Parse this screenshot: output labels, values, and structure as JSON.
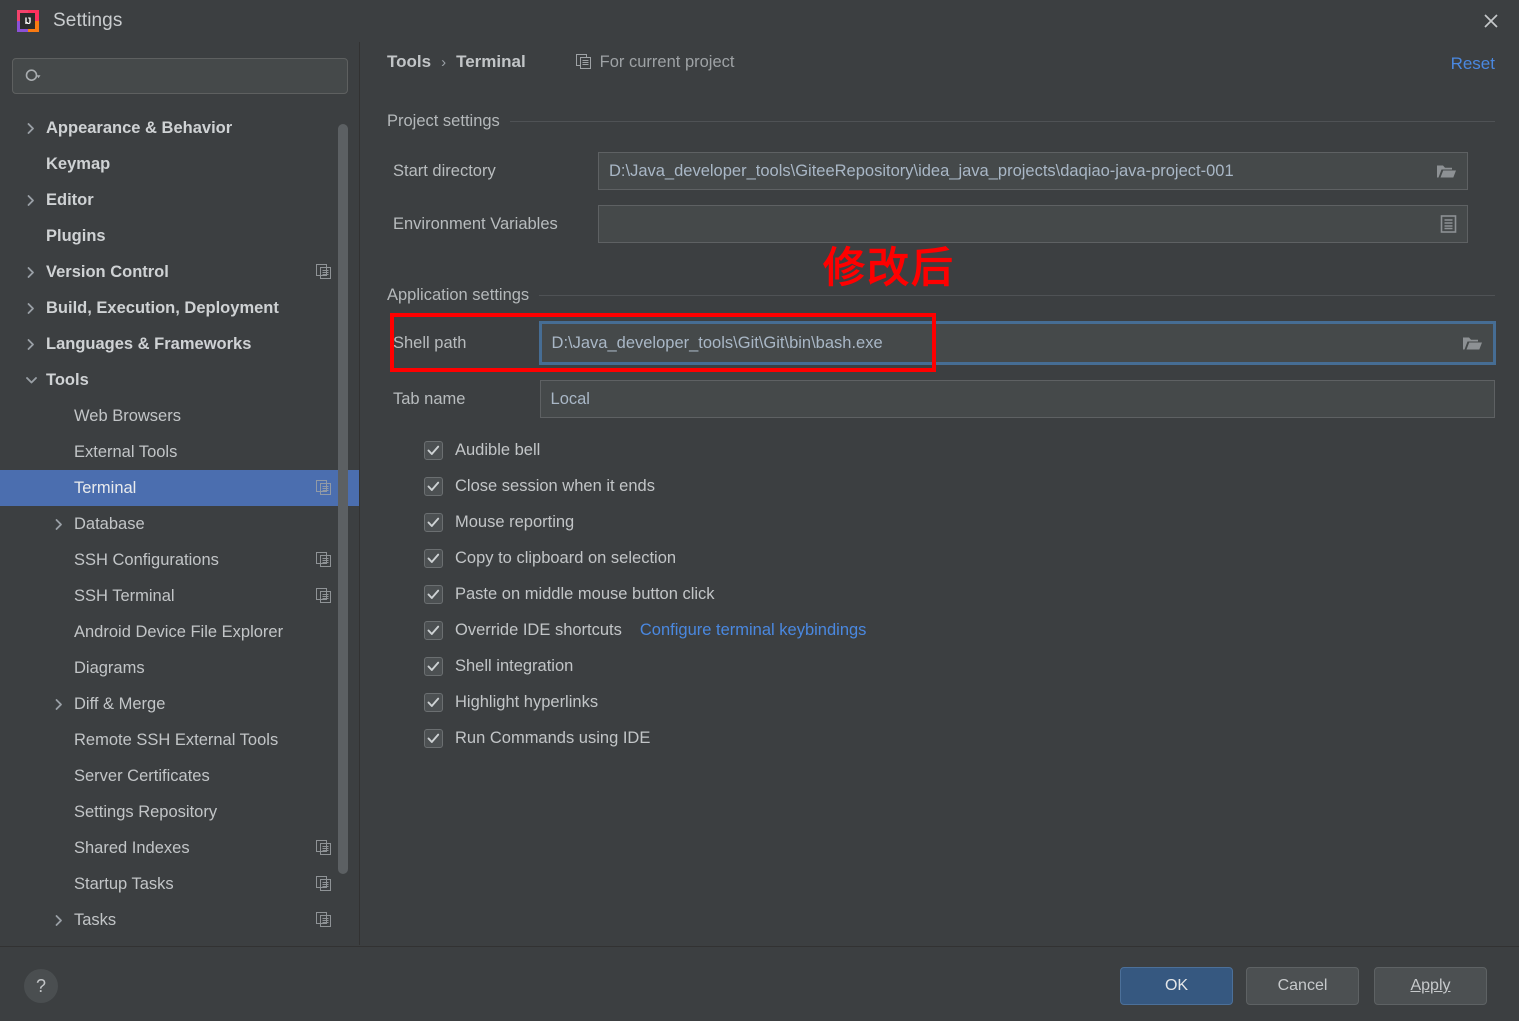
{
  "window": {
    "title": "Settings",
    "logo_badge": "IJ",
    "close_icon": "close-icon"
  },
  "search": {
    "placeholder": "",
    "value": "",
    "icon": "search-icon"
  },
  "sidebar": {
    "items": [
      {
        "label": "Appearance & Behavior",
        "indent": 0,
        "arrow": "right",
        "bold": true,
        "copy": false,
        "selected": false
      },
      {
        "label": "Keymap",
        "indent": 0,
        "arrow": "none",
        "bold": true,
        "copy": false,
        "selected": false
      },
      {
        "label": "Editor",
        "indent": 0,
        "arrow": "right",
        "bold": true,
        "copy": false,
        "selected": false
      },
      {
        "label": "Plugins",
        "indent": 0,
        "arrow": "none",
        "bold": true,
        "copy": false,
        "selected": false
      },
      {
        "label": "Version Control",
        "indent": 0,
        "arrow": "right",
        "bold": true,
        "copy": true,
        "selected": false
      },
      {
        "label": "Build, Execution, Deployment",
        "indent": 0,
        "arrow": "right",
        "bold": true,
        "copy": false,
        "selected": false
      },
      {
        "label": "Languages & Frameworks",
        "indent": 0,
        "arrow": "right",
        "bold": true,
        "copy": false,
        "selected": false
      },
      {
        "label": "Tools",
        "indent": 0,
        "arrow": "down",
        "bold": true,
        "copy": false,
        "selected": false
      },
      {
        "label": "Web Browsers",
        "indent": 1,
        "arrow": "none",
        "bold": false,
        "copy": false,
        "selected": false
      },
      {
        "label": "External Tools",
        "indent": 1,
        "arrow": "none",
        "bold": false,
        "copy": false,
        "selected": false
      },
      {
        "label": "Terminal",
        "indent": 1,
        "arrow": "none",
        "bold": false,
        "copy": true,
        "selected": true
      },
      {
        "label": "Database",
        "indent": 1,
        "arrow": "right",
        "bold": false,
        "copy": false,
        "selected": false
      },
      {
        "label": "SSH Configurations",
        "indent": 1,
        "arrow": "none",
        "bold": false,
        "copy": true,
        "selected": false
      },
      {
        "label": "SSH Terminal",
        "indent": 1,
        "arrow": "none",
        "bold": false,
        "copy": true,
        "selected": false
      },
      {
        "label": "Android Device File Explorer",
        "indent": 1,
        "arrow": "none",
        "bold": false,
        "copy": false,
        "selected": false
      },
      {
        "label": "Diagrams",
        "indent": 1,
        "arrow": "none",
        "bold": false,
        "copy": false,
        "selected": false
      },
      {
        "label": "Diff & Merge",
        "indent": 1,
        "arrow": "right",
        "bold": false,
        "copy": false,
        "selected": false
      },
      {
        "label": "Remote SSH External Tools",
        "indent": 1,
        "arrow": "none",
        "bold": false,
        "copy": false,
        "selected": false
      },
      {
        "label": "Server Certificates",
        "indent": 1,
        "arrow": "none",
        "bold": false,
        "copy": false,
        "selected": false
      },
      {
        "label": "Settings Repository",
        "indent": 1,
        "arrow": "none",
        "bold": false,
        "copy": false,
        "selected": false
      },
      {
        "label": "Shared Indexes",
        "indent": 1,
        "arrow": "none",
        "bold": false,
        "copy": true,
        "selected": false
      },
      {
        "label": "Startup Tasks",
        "indent": 1,
        "arrow": "none",
        "bold": false,
        "copy": true,
        "selected": false
      },
      {
        "label": "Tasks",
        "indent": 1,
        "arrow": "right",
        "bold": false,
        "copy": true,
        "selected": false
      }
    ]
  },
  "header": {
    "breadcrumb_root": "Tools",
    "breadcrumb_sep": "›",
    "breadcrumb_leaf": "Terminal",
    "scope_label": "For current project",
    "scope_icon": "copy-icon",
    "reset_label": "Reset"
  },
  "project_settings": {
    "group_title": "Project settings",
    "start_directory": {
      "label": "Start directory",
      "value": "D:\\Java_developer_tools\\GiteeRepository\\idea_java_projects\\daqiao-java-project-001",
      "button_icon": "folder-icon"
    },
    "environment_variables": {
      "label": "Environment Variables",
      "value": "",
      "placeholder": "",
      "button_icon": "list-icon"
    }
  },
  "application_settings": {
    "group_title": "Application settings",
    "shell_path": {
      "label": "Shell path",
      "value": "D:\\Java_developer_tools\\Git\\Git\\bin\\bash.exe",
      "button_icon": "folder-icon",
      "focused": true
    },
    "tab_name": {
      "label": "Tab name",
      "value": "Local"
    },
    "checkboxes": [
      {
        "label": "Audible bell",
        "checked": true
      },
      {
        "label": "Close session when it ends",
        "checked": true
      },
      {
        "label": "Mouse reporting",
        "checked": true
      },
      {
        "label": "Copy to clipboard on selection",
        "checked": true
      },
      {
        "label": "Paste on middle mouse button click",
        "checked": true
      },
      {
        "label": "Override IDE shortcuts",
        "checked": true,
        "link": "Configure terminal keybindings"
      },
      {
        "label": "Shell integration",
        "checked": true
      },
      {
        "label": "Highlight hyperlinks",
        "checked": true
      },
      {
        "label": "Run Commands using IDE",
        "checked": true
      }
    ]
  },
  "annotations": {
    "note_text": "修改后",
    "note_color": "#ff0000",
    "highlight_color": "#ff0000"
  },
  "footer": {
    "help_label": "?",
    "ok_label": "OK",
    "cancel_label": "Cancel",
    "apply_label": "Apply"
  },
  "colors": {
    "background": "#3c3f41",
    "selection": "#4b6eaf",
    "link": "#4a88e0",
    "field_background": "#45494a",
    "field_text": "#a9b7c6",
    "focus_border": "#466d94",
    "annotation": "#ff0000"
  }
}
